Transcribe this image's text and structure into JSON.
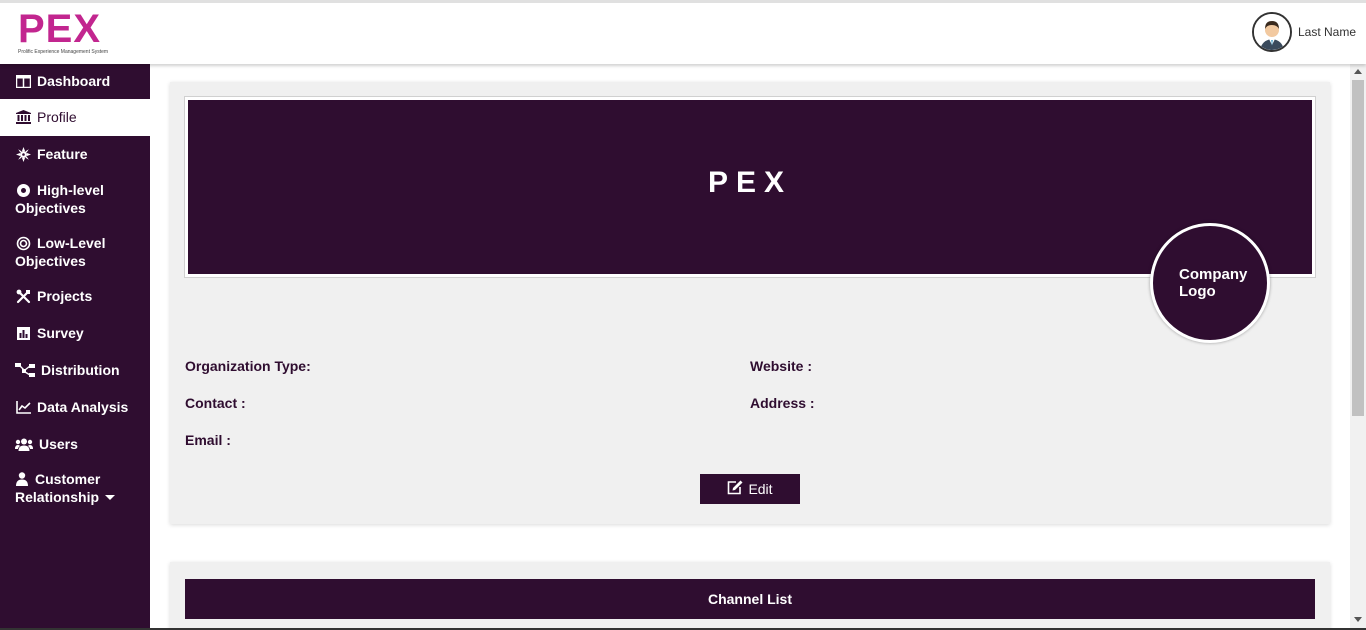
{
  "brand": {
    "name": "PEX",
    "tagline": "Prolific Experience Management System",
    "color": "#c2268f"
  },
  "user": {
    "name": "Last Name"
  },
  "sidebar": {
    "items": [
      {
        "label": "Dashboard",
        "icon": "dashboard-icon"
      },
      {
        "label": "Profile",
        "icon": "institution-icon",
        "active": true
      },
      {
        "label": "Feature",
        "icon": "cog-burst-icon"
      },
      {
        "label": "High-level",
        "label2": "Objectives",
        "icon": "dot-circle-icon"
      },
      {
        "label": "Low-Level",
        "label2": "Objectives",
        "icon": "target-icon"
      },
      {
        "label": "Projects",
        "icon": "tools-icon"
      },
      {
        "label": "Survey",
        "icon": "bar-chart-icon"
      },
      {
        "label": "Distribution",
        "icon": "sitemap-icon"
      },
      {
        "label": "Data Analysis",
        "icon": "line-chart-icon"
      },
      {
        "label": "Users",
        "icon": "users-icon"
      },
      {
        "label": "Customer",
        "label2": "Relationship",
        "icon": "user-icon",
        "dropdown": true
      }
    ]
  },
  "profile": {
    "banner_title": "PEX",
    "company_logo": {
      "line1": "Company",
      "line2": "Logo"
    },
    "fields": {
      "org_type": "Organization Type:",
      "website": "Website :",
      "contact": "Contact :",
      "address": "Address :",
      "email": "Email :"
    },
    "edit_label": "Edit"
  },
  "channels": {
    "title": "Channel List"
  },
  "colors": {
    "primary": "#2f0d30",
    "card_bg": "#f0f0f0"
  }
}
